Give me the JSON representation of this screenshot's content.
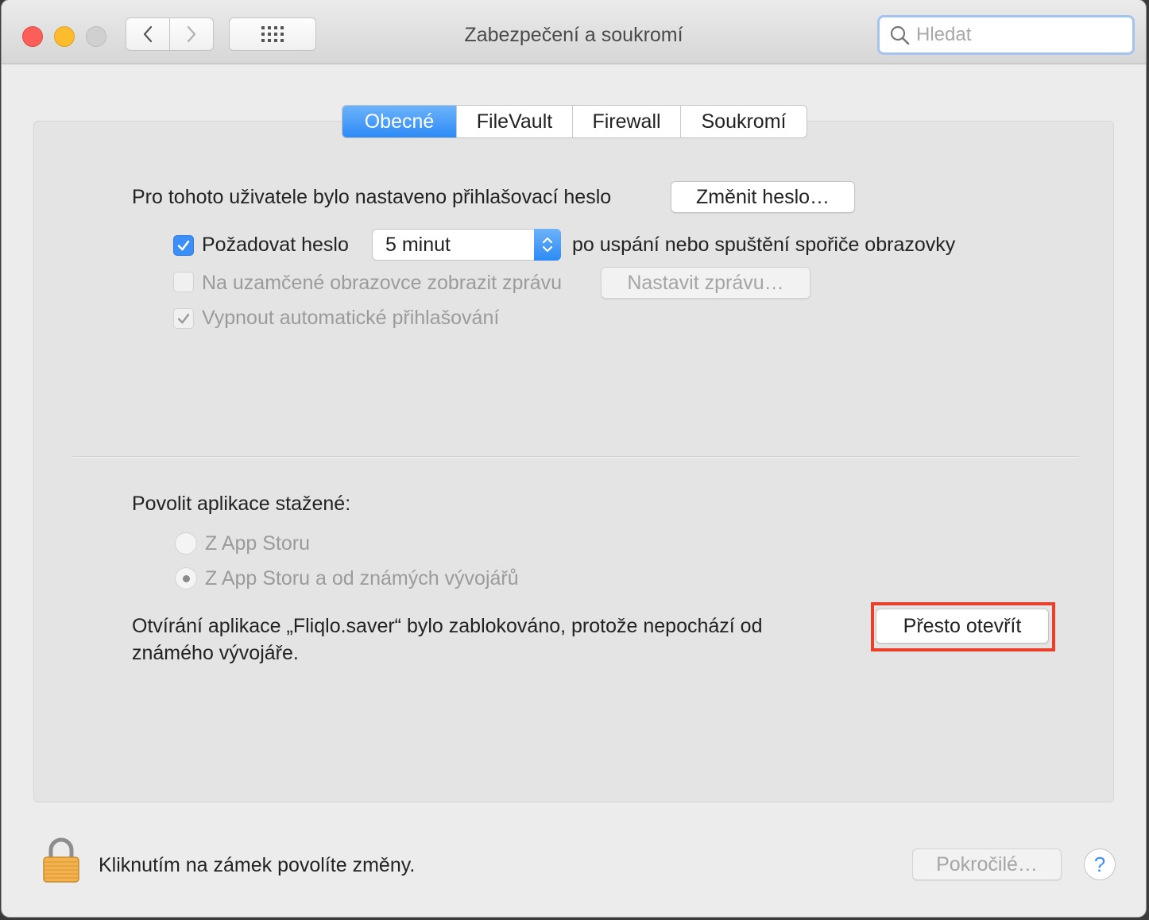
{
  "window": {
    "title": "Zabezpečení a soukromí"
  },
  "search": {
    "placeholder": "Hledat"
  },
  "tabs": [
    {
      "label": "Obecné",
      "active": true
    },
    {
      "label": "FileVault",
      "active": false
    },
    {
      "label": "Firewall",
      "active": false
    },
    {
      "label": "Soukromí",
      "active": false
    }
  ],
  "password": {
    "text": "Pro tohoto uživatele bylo nastaveno přihlašovací heslo",
    "change_button": "Změnit heslo…"
  },
  "options": {
    "require_password": {
      "label": "Požadovat heslo",
      "checked": true
    },
    "delay_value": "5 minut",
    "delay_suffix": "po uspání nebo spuštění spořiče obrazovky",
    "lock_message": {
      "label": "Na uzamčené obrazovce zobrazit zprávu",
      "checked": false,
      "enabled": false
    },
    "set_message_button": "Nastavit zprávu…",
    "disable_autologin": {
      "label": "Vypnout automatické přihlašování",
      "checked": true,
      "enabled": false
    }
  },
  "downloads": {
    "heading": "Povolit aplikace stažené:",
    "option_appstore": "Z App Storu",
    "option_identified": "Z App Storu a od známých vývojářů",
    "selected": "option_identified",
    "blocked_line1": "Otvírání aplikace „Fliqlo.saver“ bylo zablokováno, protože nepochází od",
    "blocked_line2": "známého vývojáře.",
    "open_anyway_button": "Přesto otevřít"
  },
  "footer": {
    "lock_text": "Kliknutím na zámek povolíte změny.",
    "advanced_button": "Pokročilé…",
    "help_label": "?"
  },
  "colors": {
    "accent": "#3b8ff7",
    "highlight": "#e8402a"
  }
}
